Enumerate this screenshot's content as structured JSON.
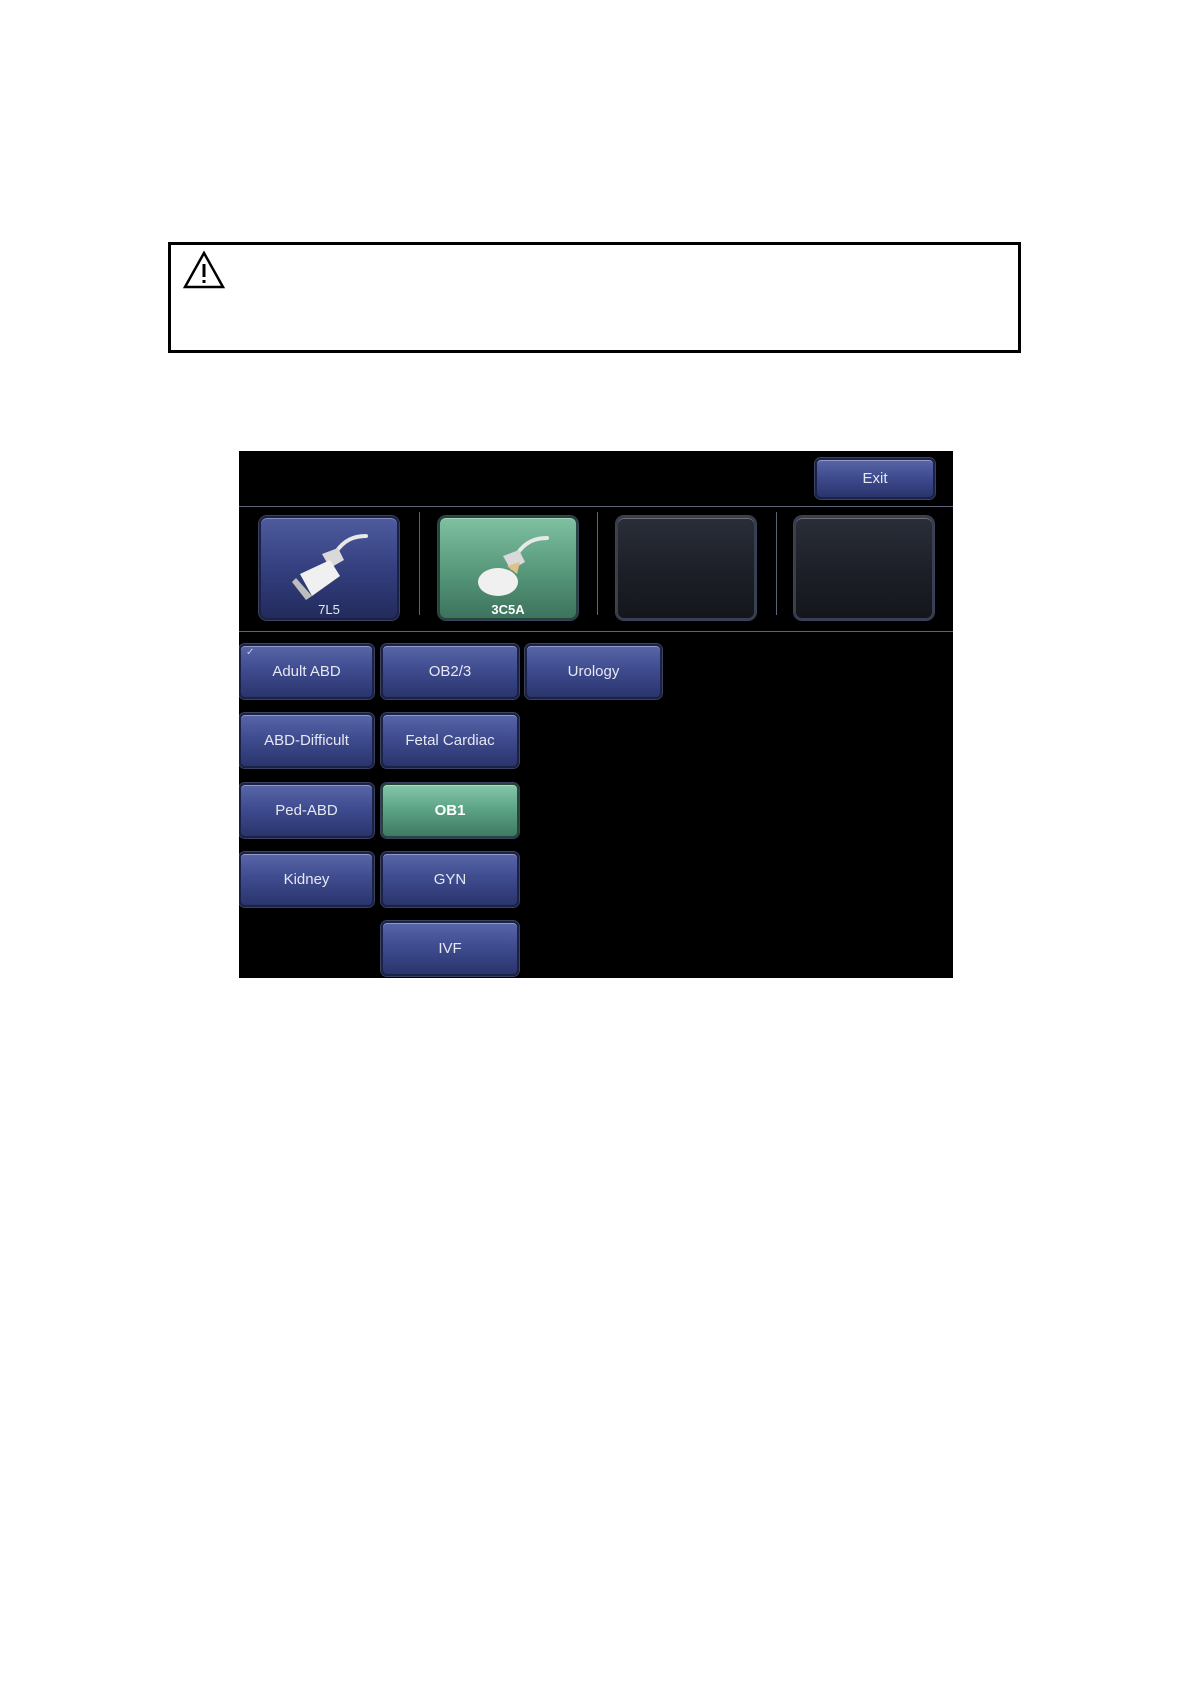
{
  "screen": {
    "exit_label": "Exit",
    "probes": [
      {
        "label": "7L5",
        "state": "normal",
        "icon": "linear-probe-icon"
      },
      {
        "label": "3C5A",
        "state": "selected",
        "icon": "convex-probe-icon"
      },
      {
        "label": "",
        "state": "empty"
      },
      {
        "label": "",
        "state": "empty"
      }
    ],
    "exams": {
      "adult_abd": "Adult ABD",
      "ob23": "OB2/3",
      "urology": "Urology",
      "abd_difficult": "ABD-Difficult",
      "fetal_cardiac": "Fetal Cardiac",
      "ped_abd": "Ped-ABD",
      "ob1": "OB1",
      "kidney": "Kidney",
      "gyn": "GYN",
      "ivf": "IVF"
    },
    "checked_mark": "✓",
    "colors": {
      "button_blue": "#3f4c8f",
      "button_selected_green": "#5ea587",
      "background": "#000000"
    }
  }
}
